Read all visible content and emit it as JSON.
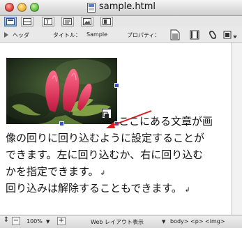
{
  "window": {
    "title": "sample.html"
  },
  "toolbar2": {
    "header_label": "ヘッダ",
    "title_label": "タイトル：",
    "title_value": "Sample",
    "properties_label": "プロパティ："
  },
  "document": {
    "lines": [
      "ここにある文章が画",
      "像の回りに回り込むように設定することが",
      "できます。左に回り込むか、右に回り込む",
      "かを指定できます。",
      "回り込みは解除することもできます。"
    ],
    "paragraph_mark": "↲"
  },
  "statusbar": {
    "zoom": "100%",
    "view_mode": "Web レイアウト表示",
    "breadcrumb": "body> <p> <img>"
  },
  "colors": {
    "accent": "#2f6fd6",
    "arrow": "#e01b1b",
    "handle": "#3a4ed8"
  }
}
